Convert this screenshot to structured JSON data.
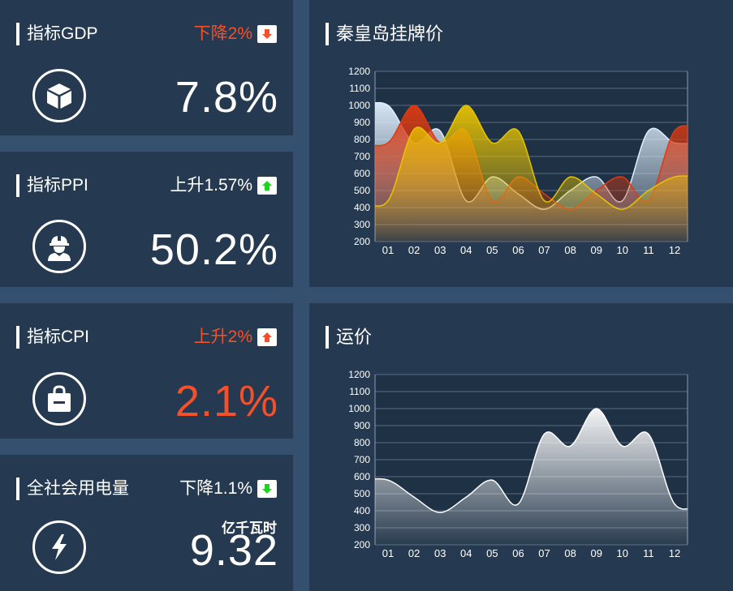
{
  "kpis": [
    {
      "title": "指标GDP",
      "trend_text": "下降2%",
      "trend_dir": "down",
      "trend_color": "#f5502a",
      "arrow_color": "#f5502a",
      "icon": "cube-icon",
      "value": "7.8%",
      "value_color": "#ffffff",
      "unit": ""
    },
    {
      "title": "指标PPI",
      "trend_text": "上升1.57%",
      "trend_dir": "up",
      "trend_color": "#ffffff",
      "arrow_color": "#1fd41f",
      "icon": "worker-icon",
      "value": "50.2%",
      "value_color": "#ffffff",
      "unit": ""
    },
    {
      "title": "指标CPI",
      "trend_text": "上升2%",
      "trend_dir": "up",
      "trend_color": "#f5502a",
      "arrow_color": "#f5502a",
      "icon": "shopping-bag-icon",
      "value": "2.1%",
      "value_color": "#f5502a",
      "unit": ""
    },
    {
      "title": "全社会用电量",
      "trend_text": "下降1.1%",
      "trend_dir": "down",
      "trend_color": "#ffffff",
      "arrow_color": "#1fd41f",
      "icon": "lightning-icon",
      "value": "9.32",
      "value_color": "#ffffff",
      "unit": "亿千瓦时"
    }
  ],
  "charts": {
    "listing_price": {
      "title": "秦皇岛挂牌价"
    },
    "freight": {
      "title": "运价"
    }
  },
  "chart_data": [
    {
      "type": "area",
      "title": "秦皇岛挂牌价",
      "categories": [
        "01",
        "02",
        "03",
        "04",
        "05",
        "06",
        "07",
        "08",
        "09",
        "10",
        "11",
        "12"
      ],
      "ylim": [
        200,
        1200
      ],
      "yticks": [
        200,
        300,
        400,
        500,
        600,
        700,
        800,
        900,
        1000,
        1100,
        1200
      ],
      "grid": true,
      "series": [
        {
          "color": "#e0f0ff",
          "values": [
            1000,
            780,
            850,
            440,
            580,
            480,
            390,
            500,
            580,
            440,
            850,
            780
          ]
        },
        {
          "color": "#dd3a10",
          "values": [
            780,
            1000,
            780,
            850,
            440,
            580,
            480,
            390,
            500,
            580,
            440,
            850
          ]
        },
        {
          "color": "#e8c300",
          "values": [
            440,
            860,
            780,
            1000,
            780,
            850,
            440,
            580,
            480,
            390,
            500,
            580
          ]
        }
      ]
    },
    {
      "type": "area",
      "title": "运价",
      "categories": [
        "01",
        "02",
        "03",
        "04",
        "05",
        "06",
        "07",
        "08",
        "09",
        "10",
        "11",
        "12"
      ],
      "ylim": [
        200,
        1200
      ],
      "yticks": [
        200,
        300,
        400,
        500,
        600,
        700,
        800,
        900,
        1000,
        1100,
        1200
      ],
      "grid": true,
      "series": [
        {
          "color": "#ffffff",
          "values": [
            580,
            480,
            390,
            480,
            580,
            440,
            850,
            780,
            1000,
            780,
            850,
            440
          ]
        }
      ]
    }
  ]
}
